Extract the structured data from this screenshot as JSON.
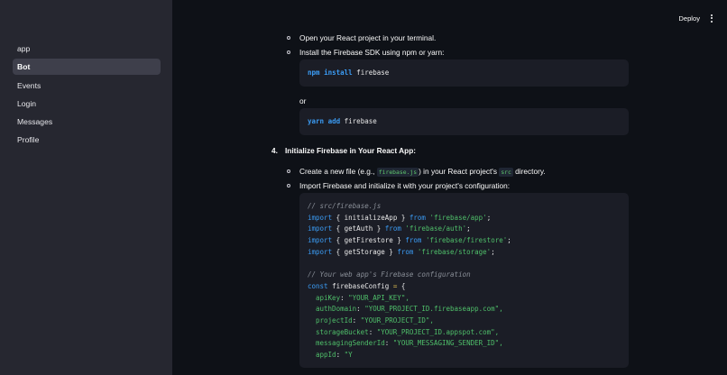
{
  "sidebar": {
    "items": [
      {
        "label": "app"
      },
      {
        "label": "Bot"
      },
      {
        "label": "Events"
      },
      {
        "label": "Login"
      },
      {
        "label": "Messages"
      },
      {
        "label": "Profile"
      }
    ]
  },
  "header": {
    "deploy_label": "Deploy"
  },
  "content": {
    "bullet_open": "Open your React project in your terminal.",
    "bullet_install": "Install the Firebase SDK using npm or yarn:",
    "npm_cmd": {
      "tool": "npm",
      "action": "install",
      "pkg": " firebase"
    },
    "or_text": "or",
    "yarn_cmd": {
      "tool": "yarn",
      "action": "add",
      "pkg": " firebase"
    },
    "step_number": "4.",
    "step_title": "Initialize Firebase in Your React App:",
    "bullet_create_pre": "Create a new file (e.g., ",
    "bullet_create_file": "firebase.js",
    "bullet_create_mid": ") in your React project's ",
    "bullet_create_dir": "src",
    "bullet_create_post": " directory.",
    "bullet_import": "Import Firebase and initialize it with your project's configuration:",
    "code": {
      "comment_path": "// src/firebase.js",
      "kw_import": "import",
      "kw_from": "from",
      "imports": [
        {
          "name": "initializeApp",
          "module": "'firebase/app'"
        },
        {
          "name": "getAuth",
          "module": "'firebase/auth'"
        },
        {
          "name": "getFirestore",
          "module": "'firebase/firestore'"
        },
        {
          "name": "getStorage",
          "module": "'firebase/storage'"
        }
      ],
      "comment_config": "// Your web app's Firebase configuration",
      "kw_const": "const",
      "var_name": "firebaseConfig",
      "config": [
        {
          "key": "apiKey",
          "value": "\"YOUR_API_KEY\","
        },
        {
          "key": "authDomain",
          "value": "\"YOUR_PROJECT_ID.firebaseapp.com\","
        },
        {
          "key": "projectId",
          "value": "\"YOUR_PROJECT_ID\","
        },
        {
          "key": "storageBucket",
          "value": "\"YOUR_PROJECT_ID.appspot.com\","
        },
        {
          "key": "messagingSenderId",
          "value": "\"YOUR_MESSAGING_SENDER_ID\","
        },
        {
          "key": "appId",
          "value": "\"Y"
        }
      ]
    }
  },
  "colors": {
    "background": "#0e1117",
    "sidebar": "#262730",
    "code_background": "#1b1d26",
    "keyword": "#3b9cf5",
    "string": "#4fbf6a",
    "comment": "#8a8f98"
  }
}
